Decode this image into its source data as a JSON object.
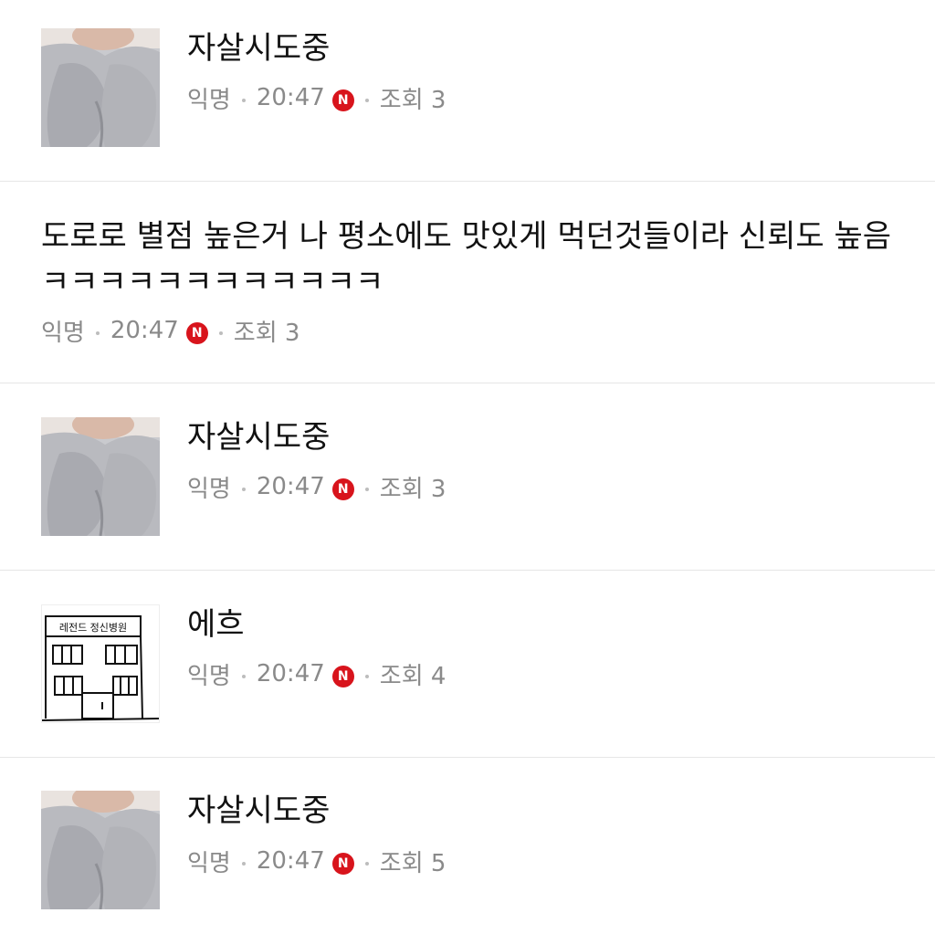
{
  "posts": [
    {
      "title": "자살시도중",
      "author": "익명",
      "time": "20:47",
      "new_badge": "N",
      "views": "조회 3",
      "thumb_icon": "photo-sweater-thumbnail"
    },
    {
      "body": "도로로 별점 높은거 나 평소에도 맛있게 먹던것들이라 신뢰도 높음ㅋㅋㅋㅋㅋㅋㅋㅋㅋㅋㅋㅋ",
      "author": "익명",
      "time": "20:47",
      "new_badge": "N",
      "views": "조회 3"
    },
    {
      "title": "자살시도중",
      "author": "익명",
      "time": "20:47",
      "new_badge": "N",
      "views": "조회 3",
      "thumb_icon": "photo-sweater-thumbnail"
    },
    {
      "title": "에흐",
      "author": "익명",
      "time": "20:47",
      "new_badge": "N",
      "views": "조회 4",
      "thumb_icon": "hospital-drawing-thumbnail",
      "thumb_sign": "레전드 정신병원"
    },
    {
      "title": "자살시도중",
      "author": "익명",
      "time": "20:47",
      "new_badge": "N",
      "views": "조회 5",
      "thumb_icon": "photo-sweater-thumbnail"
    }
  ],
  "colors": {
    "badge": "#d8141c",
    "meta_text": "#8a8a8a",
    "divider": "#e6e6e6"
  }
}
